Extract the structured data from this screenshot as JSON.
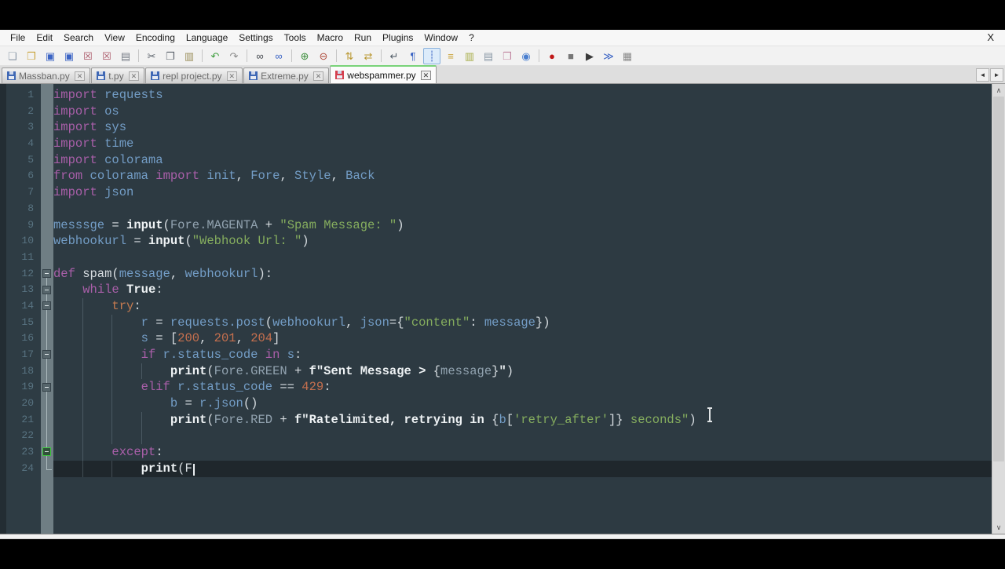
{
  "menubar": {
    "items": [
      "File",
      "Edit",
      "Search",
      "View",
      "Encoding",
      "Language",
      "Settings",
      "Tools",
      "Macro",
      "Run",
      "Plugins",
      "Window",
      "?"
    ],
    "close": "X"
  },
  "toolbar": {
    "icons": [
      {
        "name": "new-file",
        "glyph": "❏",
        "color": "#8a98a6"
      },
      {
        "name": "open-file",
        "glyph": "❒",
        "color": "#c9a43c"
      },
      {
        "name": "save",
        "glyph": "▣",
        "color": "#3b64c4"
      },
      {
        "name": "save-all",
        "glyph": "▣",
        "color": "#3b64c4"
      },
      {
        "name": "close-file",
        "glyph": "☒",
        "color": "#aa5566"
      },
      {
        "name": "close-all",
        "glyph": "☒",
        "color": "#aa5566"
      },
      {
        "name": "print",
        "glyph": "▤",
        "color": "#767c86"
      },
      {
        "name": "cut",
        "glyph": "✂",
        "color": "#5b626b",
        "sep": true
      },
      {
        "name": "copy",
        "glyph": "❐",
        "color": "#5b626b"
      },
      {
        "name": "paste",
        "glyph": "▥",
        "color": "#9a8e5a"
      },
      {
        "name": "undo",
        "glyph": "↶",
        "color": "#3f9e3f",
        "sep": true
      },
      {
        "name": "redo",
        "glyph": "↷",
        "color": "#8a8a8a"
      },
      {
        "name": "find",
        "glyph": "∞",
        "color": "#44484e",
        "sep": true
      },
      {
        "name": "replace",
        "glyph": "∞",
        "color": "#3b64c4"
      },
      {
        "name": "zoom-in",
        "glyph": "⊕",
        "color": "#3f8f3f",
        "sep": true
      },
      {
        "name": "zoom-out",
        "glyph": "⊖",
        "color": "#b04f3f"
      },
      {
        "name": "sync-vertical-scroll",
        "glyph": "⇅",
        "color": "#b8962e",
        "sep": true
      },
      {
        "name": "sync-horizontal-scroll",
        "glyph": "⇄",
        "color": "#b8962e"
      },
      {
        "name": "word-wrap",
        "glyph": "↵",
        "color": "#55606b",
        "sep": true
      },
      {
        "name": "show-all-characters",
        "glyph": "¶",
        "color": "#3b64c4"
      },
      {
        "name": "show-indent-guide",
        "glyph": "┊",
        "color": "#3b64c4",
        "pressed": true
      },
      {
        "name": "function-list",
        "glyph": "≡",
        "color": "#c9a43c"
      },
      {
        "name": "document-map",
        "glyph": "▥",
        "color": "#a8ae4a"
      },
      {
        "name": "document-list",
        "glyph": "▤",
        "color": "#8a98a6"
      },
      {
        "name": "folder-as-workspace",
        "glyph": "❒",
        "color": "#c287a2"
      },
      {
        "name": "monitoring",
        "glyph": "◉",
        "color": "#4a7fd0"
      },
      {
        "name": "macro-record",
        "glyph": "●",
        "color": "#c01818",
        "sep": true
      },
      {
        "name": "macro-stop",
        "glyph": "■",
        "color": "#777777"
      },
      {
        "name": "macro-play",
        "glyph": "▶",
        "color": "#3a3a3a"
      },
      {
        "name": "macro-run-multiple",
        "glyph": "≫",
        "color": "#3b64c4"
      },
      {
        "name": "macro-save",
        "glyph": "▦",
        "color": "#8a8a8a"
      }
    ]
  },
  "tabbar": {
    "tabs": [
      {
        "label": "Massban.py",
        "modified": false,
        "active": false
      },
      {
        "label": "t.py",
        "modified": false,
        "active": false
      },
      {
        "label": "repl project.py",
        "modified": false,
        "active": false
      },
      {
        "label": "Extreme.py",
        "modified": false,
        "active": false
      },
      {
        "label": "webspammer.py",
        "modified": true,
        "active": true
      }
    ],
    "close_glyph": "✕",
    "scroll_left": "◄",
    "scroll_right": "►"
  },
  "editor": {
    "theme": {
      "background": "#2d3a42",
      "caret_line": "#1f272c",
      "keyword": "#a95fa9",
      "keyword_alt": "#c47a50",
      "identifier": "#739dc6",
      "attribute": "#92a3b0",
      "string": "#85ad5e",
      "number": "#c7704e",
      "default_text": "#d7dde1",
      "bold_builtin": "#eef2f4",
      "line_number": "#587381",
      "fold_active": "#3ecb3e"
    },
    "lines": [
      {
        "n": 1,
        "m": "",
        "guides": [],
        "tokens": [
          [
            "kw",
            "import"
          ],
          [
            "df",
            " "
          ],
          [
            "id",
            "requests"
          ]
        ]
      },
      {
        "n": 2,
        "m": "",
        "guides": [],
        "tokens": [
          [
            "kw",
            "import"
          ],
          [
            "df",
            " "
          ],
          [
            "id",
            "os"
          ]
        ]
      },
      {
        "n": 3,
        "m": "",
        "guides": [],
        "tokens": [
          [
            "kw",
            "import"
          ],
          [
            "df",
            " "
          ],
          [
            "id",
            "sys"
          ]
        ]
      },
      {
        "n": 4,
        "m": "",
        "guides": [],
        "tokens": [
          [
            "kw",
            "import"
          ],
          [
            "df",
            " "
          ],
          [
            "id",
            "time"
          ]
        ]
      },
      {
        "n": 5,
        "m": "",
        "guides": [],
        "tokens": [
          [
            "kw",
            "import"
          ],
          [
            "df",
            " "
          ],
          [
            "id",
            "colorama"
          ]
        ]
      },
      {
        "n": 6,
        "m": "",
        "guides": [],
        "tokens": [
          [
            "kw",
            "from"
          ],
          [
            "df",
            " "
          ],
          [
            "id",
            "colorama"
          ],
          [
            "df",
            " "
          ],
          [
            "kw",
            "import"
          ],
          [
            "df",
            " "
          ],
          [
            "id",
            "init"
          ],
          [
            "df",
            ", "
          ],
          [
            "id",
            "Fore"
          ],
          [
            "df",
            ", "
          ],
          [
            "id",
            "Style"
          ],
          [
            "df",
            ", "
          ],
          [
            "id",
            "Back"
          ]
        ]
      },
      {
        "n": 7,
        "m": "",
        "guides": [],
        "tokens": [
          [
            "kw",
            "import"
          ],
          [
            "df",
            " "
          ],
          [
            "id",
            "json"
          ]
        ]
      },
      {
        "n": 8,
        "m": "",
        "guides": [],
        "tokens": []
      },
      {
        "n": 9,
        "m": "",
        "guides": [],
        "tokens": [
          [
            "id",
            "messsge"
          ],
          [
            "df",
            " = "
          ],
          [
            "bw",
            "input"
          ],
          [
            "df",
            "("
          ],
          [
            "at",
            "Fore.MAGENTA"
          ],
          [
            "df",
            " + "
          ],
          [
            "st",
            "\"Spam Message: \""
          ],
          [
            "df",
            ")"
          ]
        ]
      },
      {
        "n": 10,
        "m": "",
        "guides": [],
        "tokens": [
          [
            "id",
            "webhookurl"
          ],
          [
            "df",
            " = "
          ],
          [
            "bw",
            "input"
          ],
          [
            "df",
            "("
          ],
          [
            "st",
            "\"Webhook Url: \""
          ],
          [
            "df",
            ")"
          ]
        ]
      },
      {
        "n": 11,
        "m": "",
        "guides": [],
        "tokens": []
      },
      {
        "n": 12,
        "m": "bd",
        "guides": [],
        "tokens": [
          [
            "kw",
            "def"
          ],
          [
            "df",
            " spam("
          ],
          [
            "id",
            "message"
          ],
          [
            "df",
            ", "
          ],
          [
            "id",
            "webhookurl"
          ],
          [
            "df",
            "):"
          ]
        ]
      },
      {
        "n": 13,
        "m": "bb",
        "guides": [],
        "tokens": [
          [
            "df",
            "    "
          ],
          [
            "kw",
            "while"
          ],
          [
            "df",
            " "
          ],
          [
            "bw",
            "True"
          ],
          [
            "df",
            ":"
          ]
        ]
      },
      {
        "n": 14,
        "m": "bb",
        "guides": [
          4
        ],
        "tokens": [
          [
            "df",
            "        "
          ],
          [
            "kw2",
            "try"
          ],
          [
            "df",
            ":"
          ]
        ]
      },
      {
        "n": 15,
        "m": "v",
        "guides": [
          4,
          8
        ],
        "tokens": [
          [
            "df",
            "            "
          ],
          [
            "id",
            "r"
          ],
          [
            "df",
            " = "
          ],
          [
            "id",
            "requests.post"
          ],
          [
            "df",
            "("
          ],
          [
            "id",
            "webhookurl"
          ],
          [
            "df",
            ", "
          ],
          [
            "id",
            "json"
          ],
          [
            "df",
            "={"
          ],
          [
            "st",
            "\"content\""
          ],
          [
            "df",
            ": "
          ],
          [
            "id",
            "message"
          ],
          [
            "df",
            "})"
          ]
        ]
      },
      {
        "n": 16,
        "m": "v",
        "guides": [
          4,
          8
        ],
        "tokens": [
          [
            "df",
            "            "
          ],
          [
            "id",
            "s"
          ],
          [
            "df",
            " = ["
          ],
          [
            "nu",
            "200"
          ],
          [
            "df",
            ", "
          ],
          [
            "nu",
            "201"
          ],
          [
            "df",
            ", "
          ],
          [
            "nu",
            "204"
          ],
          [
            "df",
            "]"
          ]
        ]
      },
      {
        "n": 17,
        "m": "bb",
        "guides": [
          4,
          8
        ],
        "tokens": [
          [
            "df",
            "            "
          ],
          [
            "kw",
            "if"
          ],
          [
            "df",
            " "
          ],
          [
            "id",
            "r.status_code"
          ],
          [
            "df",
            " "
          ],
          [
            "kw",
            "in"
          ],
          [
            "df",
            " "
          ],
          [
            "id",
            "s"
          ],
          [
            "df",
            ":"
          ]
        ]
      },
      {
        "n": 18,
        "m": "v",
        "guides": [
          4,
          8,
          12
        ],
        "tokens": [
          [
            "df",
            "                "
          ],
          [
            "bw",
            "print"
          ],
          [
            "df",
            "("
          ],
          [
            "at",
            "Fore.GREEN"
          ],
          [
            "df",
            " + "
          ],
          [
            "bw",
            "f\"Sent Message > "
          ],
          [
            "df",
            "{"
          ],
          [
            "at",
            "message"
          ],
          [
            "df",
            "}"
          ],
          [
            "bw",
            "\""
          ],
          [
            "df",
            ")"
          ]
        ]
      },
      {
        "n": 19,
        "m": "bb",
        "guides": [
          4,
          8
        ],
        "tokens": [
          [
            "df",
            "            "
          ],
          [
            "kw",
            "elif"
          ],
          [
            "df",
            " "
          ],
          [
            "id",
            "r.status_code"
          ],
          [
            "df",
            " == "
          ],
          [
            "nu",
            "429"
          ],
          [
            "df",
            ":"
          ]
        ]
      },
      {
        "n": 20,
        "m": "v",
        "guides": [
          4,
          8
        ],
        "tokens": [
          [
            "df",
            "                "
          ],
          [
            "id",
            "b"
          ],
          [
            "df",
            " = "
          ],
          [
            "id",
            "r.json"
          ],
          [
            "df",
            "()"
          ]
        ]
      },
      {
        "n": 21,
        "m": "v",
        "guides": [
          4,
          8,
          12
        ],
        "tokens": [
          [
            "df",
            "                "
          ],
          [
            "bw",
            "print"
          ],
          [
            "df",
            "("
          ],
          [
            "at",
            "Fore.RED"
          ],
          [
            "df",
            " + "
          ],
          [
            "bw",
            "f\"Ratelimited, retrying in "
          ],
          [
            "df",
            "{"
          ],
          [
            "id",
            "b"
          ],
          [
            "df",
            "["
          ],
          [
            "st",
            "'retry_after'"
          ],
          [
            "df",
            "]} "
          ],
          [
            "st",
            "seconds\""
          ],
          [
            "df",
            ")"
          ]
        ]
      },
      {
        "n": 22,
        "m": "v",
        "guides": [
          4,
          8,
          12
        ],
        "tokens": []
      },
      {
        "n": 23,
        "m": "g",
        "guides": [
          4
        ],
        "tokens": [
          [
            "df",
            "        "
          ],
          [
            "kw",
            "except"
          ],
          [
            "df",
            ":"
          ]
        ]
      },
      {
        "n": 24,
        "m": "e",
        "guides": [
          4,
          8
        ],
        "cur": true,
        "caret": true,
        "tokens": [
          [
            "df",
            "            "
          ],
          [
            "bw",
            "print"
          ],
          [
            "df",
            "("
          ],
          [
            "df",
            "F"
          ]
        ]
      }
    ]
  },
  "scrollbar": {
    "up_glyph": "∧",
    "down_glyph": "∨"
  }
}
